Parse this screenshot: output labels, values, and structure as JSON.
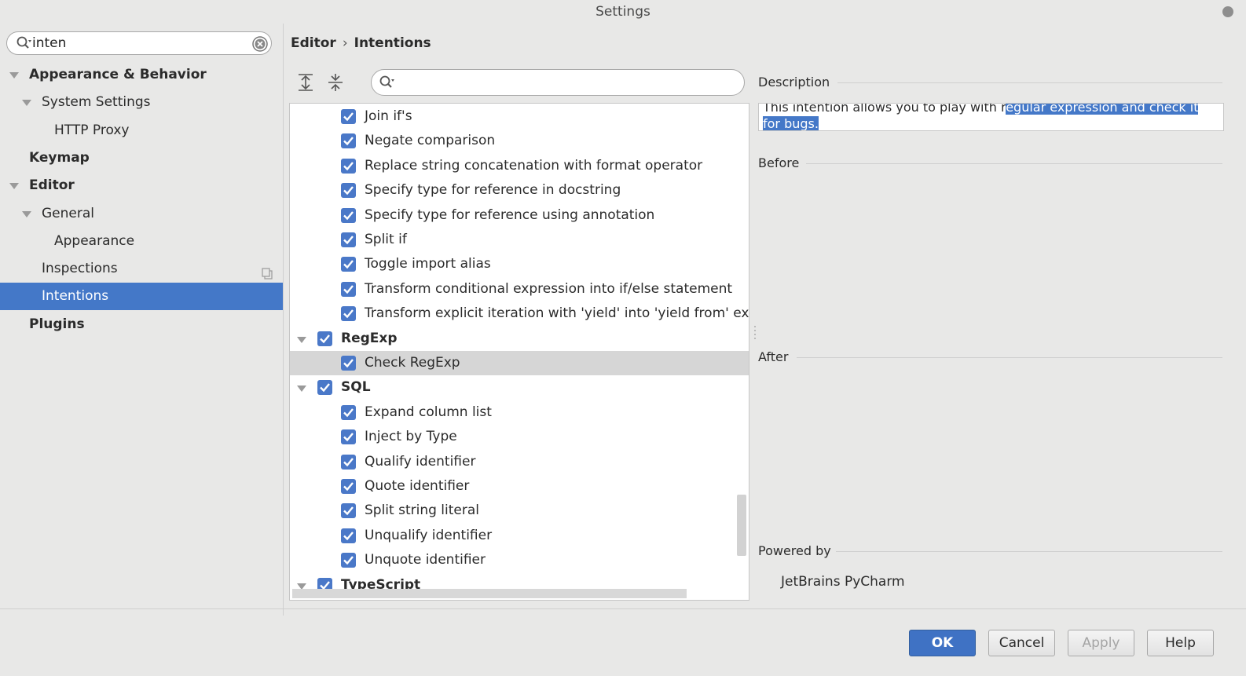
{
  "window": {
    "title": "Settings"
  },
  "search": {
    "value": "inten"
  },
  "sidebar": {
    "items": [
      {
        "label": "Appearance & Behavior",
        "bold": true,
        "expanded": true,
        "level": 0
      },
      {
        "label": "System Settings",
        "bold": false,
        "expanded": true,
        "level": 1
      },
      {
        "label": "HTTP Proxy",
        "bold": false,
        "level": 2
      },
      {
        "label": "Keymap",
        "bold": true,
        "level": 0
      },
      {
        "label": "Editor",
        "bold": true,
        "expanded": true,
        "level": 0
      },
      {
        "label": "General",
        "bold": false,
        "expanded": true,
        "level": 1
      },
      {
        "label": "Appearance",
        "bold": false,
        "level": 2
      },
      {
        "label": "Inspections",
        "bold": false,
        "level": 1
      },
      {
        "label": "Intentions",
        "bold": false,
        "level": 1,
        "selected": true
      },
      {
        "label": "Plugins",
        "bold": true,
        "level": 0
      }
    ]
  },
  "breadcrumb": {
    "parent": "Editor",
    "separator": "›",
    "current": "Intentions"
  },
  "filter": {
    "value": ""
  },
  "intentions": {
    "rows": [
      {
        "label": "Join if's",
        "checked": true,
        "group": false
      },
      {
        "label": "Negate comparison",
        "checked": true,
        "group": false
      },
      {
        "label": "Replace string concatenation with format operator",
        "checked": true,
        "group": false
      },
      {
        "label": "Specify type for reference in docstring",
        "checked": true,
        "group": false
      },
      {
        "label": "Specify type for reference using annotation",
        "checked": true,
        "group": false
      },
      {
        "label": "Split if",
        "checked": true,
        "group": false
      },
      {
        "label": "Toggle import alias",
        "checked": true,
        "group": false
      },
      {
        "label": "Transform conditional expression into if/else statement",
        "checked": true,
        "group": false
      },
      {
        "label": "Transform explicit iteration with 'yield' into 'yield from' expre",
        "checked": true,
        "group": false
      },
      {
        "label": "RegExp",
        "checked": true,
        "group": true
      },
      {
        "label": "Check RegExp",
        "checked": true,
        "group": false,
        "highlighted": true
      },
      {
        "label": "SQL",
        "checked": true,
        "group": true
      },
      {
        "label": "Expand column list",
        "checked": true,
        "group": false
      },
      {
        "label": "Inject by Type",
        "checked": true,
        "group": false
      },
      {
        "label": "Qualify identifier",
        "checked": true,
        "group": false
      },
      {
        "label": "Quote identifier",
        "checked": true,
        "group": false
      },
      {
        "label": "Split string literal",
        "checked": true,
        "group": false
      },
      {
        "label": "Unqualify identifier",
        "checked": true,
        "group": false
      },
      {
        "label": "Unquote identifier",
        "checked": true,
        "group": false
      },
      {
        "label": "TypeScript",
        "checked": true,
        "group": true
      }
    ]
  },
  "details": {
    "description_heading": "Description",
    "description_plain": "This intention allows you to play with r",
    "description_selected": "egular expression and check it for bugs.",
    "before_heading": "Before",
    "after_heading": "After",
    "powered_heading": "Powered by",
    "powered_name": "JetBrains PyCharm"
  },
  "buttons": {
    "ok": "OK",
    "cancel": "Cancel",
    "apply": "Apply",
    "help": "Help"
  },
  "colors": {
    "accent": "#4478c8",
    "checkbox": "#4a78c8",
    "selected_row": "#d6d6d6"
  }
}
